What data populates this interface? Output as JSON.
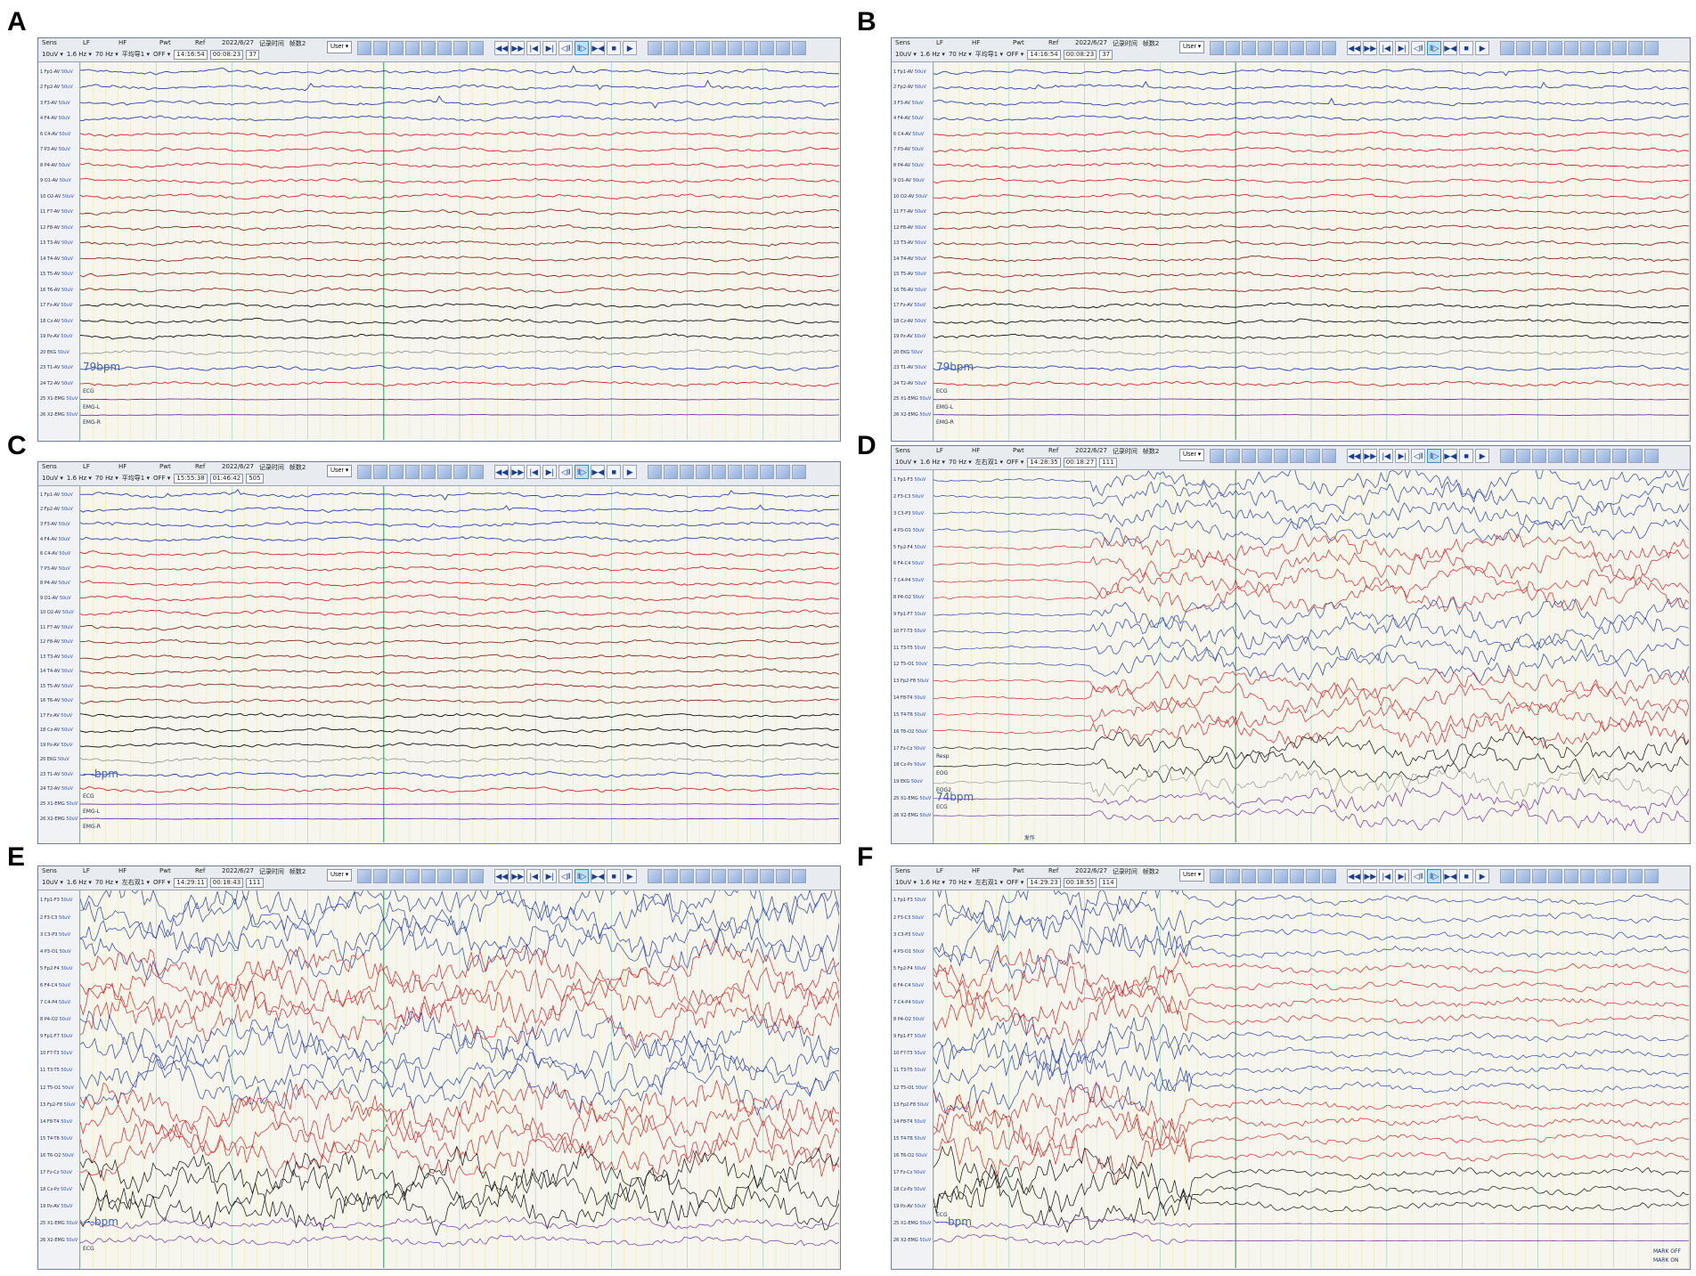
{
  "panels": [
    {
      "label": "A",
      "toolbar": {
        "sens": "10uV",
        "lf": "1.6 Hz",
        "hf": "70 Hz",
        "pwt": "平均导1",
        "ref": "OFF",
        "date": "2022/6/27",
        "time_label": "记录时间",
        "page_label": "帧数2",
        "clock": "14:16:54",
        "rec_time": "00:08:23",
        "page": "37",
        "user": "User"
      },
      "bpm": "79bpm",
      "channels": [
        "1 Fp1-AV",
        "2 Fp2-AV",
        "3 F3-AV",
        "4 F4-AV",
        "6 C4-AV",
        "7 P3-AV",
        "8 P4-AV",
        "9 O1-AV",
        "10 O2-AV",
        "11 F7-AV",
        "12 F8-AV",
        "13 T3-AV",
        "14 T4-AV",
        "15 T5-AV",
        "16 T6-AV",
        "17 Fz-AV",
        "18 Cz-AV",
        "19 Pz-AV",
        "20 EKG",
        "23 T1-AV",
        "24 T2-AV",
        "25 X1-EMG",
        "26 X2-EMG"
      ],
      "marks": [
        "ECG",
        "EMG-L",
        "EMG-R"
      ]
    },
    {
      "label": "B",
      "toolbar": {
        "sens": "10uV",
        "lf": "1.6 Hz",
        "hf": "70 Hz",
        "pwt": "平均导1",
        "ref": "OFF",
        "date": "2022/6/27",
        "time_label": "记录时间",
        "page_label": "帧数2",
        "clock": "14:16:54",
        "rec_time": "00:08:23",
        "page": "37",
        "user": "User"
      },
      "bpm": "79bpm",
      "channels": [
        "1 Fp1-AV",
        "2 Fp2-AV",
        "3 F3-AV",
        "4 F4-AV",
        "6 C4-AV",
        "7 P3-AV",
        "8 P4-AV",
        "9 O1-AV",
        "10 O2-AV",
        "11 F7-AV",
        "12 F8-AV",
        "13 T3-AV",
        "14 T4-AV",
        "15 T5-AV",
        "16 T6-AV",
        "17 Fz-AV",
        "18 Cz-AV",
        "19 Pz-AV",
        "20 EKG",
        "23 T1-AV",
        "24 T2-AV",
        "25 X1-EMG",
        "26 X2-EMG"
      ],
      "marks": [
        "ECG",
        "EMG-L",
        "EMG-R"
      ]
    },
    {
      "label": "C",
      "toolbar": {
        "sens": "10uV",
        "lf": "1.6 Hz",
        "hf": "70 Hz",
        "pwt": "平均导1",
        "ref": "OFF",
        "date": "2022/6/27",
        "time_label": "记录时间",
        "page_label": "帧数2",
        "clock": "15:55:38",
        "rec_time": "01:46:42",
        "page": "505",
        "user": "User"
      },
      "bpm": "---bpm",
      "channels": [
        "1 Fp1-AV",
        "2 Fp2-AV",
        "3 F3-AV",
        "4 F4-AV",
        "6 C4-AV",
        "7 P3-AV",
        "8 P4-AV",
        "9 O1-AV",
        "10 O2-AV",
        "11 F7-AV",
        "12 F8-AV",
        "13 T3-AV",
        "14 T4-AV",
        "15 T5-AV",
        "16 T6-AV",
        "17 Fz-AV",
        "18 Cz-AV",
        "19 Pz-AV",
        "20 EKG",
        "23 T1-AV",
        "24 T2-AV",
        "25 X1-EMG",
        "26 X2-EMG"
      ],
      "marks": [
        "ECG",
        "EMG-L",
        "EMG-R"
      ]
    },
    {
      "label": "D",
      "toolbar": {
        "sens": "10uV",
        "lf": "1.6 Hz",
        "hf": "70 Hz",
        "pwt": "左右双1",
        "ref": "OFF",
        "date": "2022/6/27",
        "time_label": "记录时间",
        "page_label": "帧数2",
        "clock": "14:28:35",
        "rec_time": "00:18:27",
        "page": "111",
        "user": "User"
      },
      "bpm": "74bpm",
      "channels": [
        "1 Fp1-F3",
        "2 F3-C3",
        "3 C3-P3",
        "4 P3-O1",
        "5 Fp2-F4",
        "6 F4-C4",
        "7 C4-P4",
        "8 P4-O2",
        "9 Fp1-F7",
        "10 F7-T3",
        "11 T3-T5",
        "12 T5-O1",
        "13 Fp2-F8",
        "14 F8-T4",
        "15 T4-T6",
        "16 T6-O2",
        "17 Fz-Cz",
        "18 Cz-Pz",
        "19 EKG",
        "25 X1-EMG",
        "26 X2-EMG"
      ],
      "marks": [
        "Resp",
        "EOG",
        "EOG2",
        "ECG",
        "发作"
      ]
    },
    {
      "label": "E",
      "toolbar": {
        "sens": "10uV",
        "lf": "1.6 Hz",
        "hf": "70 Hz",
        "pwt": "左右双1",
        "ref": "OFF",
        "date": "2022/6/27",
        "time_label": "记录时间",
        "page_label": "帧数2",
        "clock": "14:29:11",
        "rec_time": "00:18:43",
        "page": "111",
        "user": "User"
      },
      "bpm": "---bpm",
      "channels": [
        "1 Fp1-F3",
        "2 F3-C3",
        "3 C3-P3",
        "4 P3-O1",
        "5 Fp2-F4",
        "6 F4-C4",
        "7 C4-P4",
        "8 P4-O2",
        "9 Fp1-F7",
        "10 F7-T3",
        "11 T3-T5",
        "12 T5-O1",
        "13 Fp2-F8",
        "14 F8-T4",
        "15 T4-T6",
        "16 T6-O2",
        "17 Fz-Cz",
        "18 Cz-Pz",
        "19 Pz-AV",
        "25 X1-EMG",
        "26 X2-EMG"
      ],
      "marks": [
        "ECG"
      ]
    },
    {
      "label": "F",
      "toolbar": {
        "sens": "10uV",
        "lf": "1.6 Hz",
        "hf": "70 Hz",
        "pwt": "左右双1",
        "ref": "OFF",
        "date": "2022/6/27",
        "time_label": "记录时间",
        "page_label": "帧数2",
        "clock": "14:29:23",
        "rec_time": "00:18:55",
        "page": "114",
        "user": "User"
      },
      "bpm": "---bpm",
      "channels": [
        "1 Fp1-F3",
        "2 F3-C3",
        "3 C3-P3",
        "4 P3-O1",
        "5 Fp2-F4",
        "6 F4-C4",
        "7 C4-P4",
        "8 P4-O2",
        "9 Fp1-F7",
        "10 F7-T3",
        "11 T3-T5",
        "12 T5-O1",
        "13 Fp2-F8",
        "14 F8-T4",
        "15 T4-T6",
        "16 T6-O2",
        "17 Fz-Cz",
        "18 Cz-Pz",
        "19 Pz-AV",
        "25 X1-EMG",
        "26 X2-EMG"
      ],
      "marks": [
        "ECG",
        "MARK OFF",
        "MARK ON"
      ]
    }
  ],
  "header_labels": {
    "sens": "Sens",
    "lf": "LF",
    "hf": "HF",
    "pwt": "Pwt",
    "ref": "Ref"
  },
  "unit": "50uV",
  "colors": {
    "blue": "#2a44b0",
    "red": "#d4262a",
    "darkred": "#8a2a1a",
    "black": "#111111",
    "purple": "#7b2fa8",
    "grid_yellow": "#e8e07a",
    "grid_green": "#36b06a"
  }
}
